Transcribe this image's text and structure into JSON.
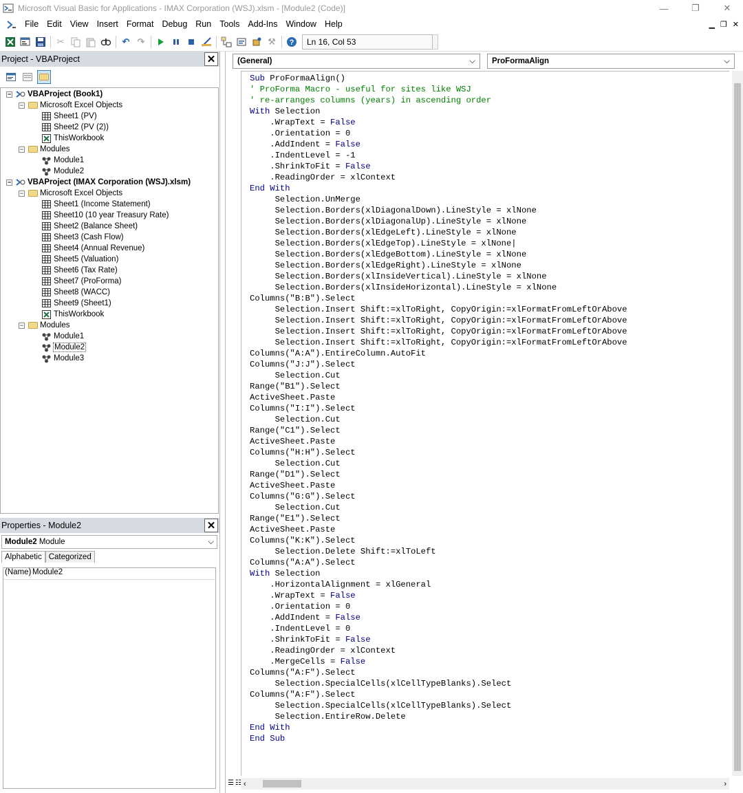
{
  "window": {
    "title": "Microsoft Visual Basic for Applications - IMAX Corporation (WSJ).xlsm - [Module2 (Code)]",
    "min_glyph": "—",
    "max_glyph": "❐",
    "close_glyph": "✕"
  },
  "menu": {
    "items": [
      "File",
      "Edit",
      "View",
      "Insert",
      "Format",
      "Debug",
      "Run",
      "Tools",
      "Add-Ins",
      "Window",
      "Help"
    ],
    "mdi_min": "▁",
    "mdi_restore": "❐",
    "mdi_close": "✕"
  },
  "toolbar": {
    "cursor_position": "Ln 16, Col 53",
    "icons": [
      "excel-icon",
      "insert-userform-icon",
      "save-icon",
      "cut-icon",
      "copy-icon",
      "paste-icon",
      "find-icon",
      "undo-icon",
      "redo-icon",
      "run-icon",
      "break-icon",
      "reset-icon",
      "design-mode-icon",
      "project-explorer-icon",
      "properties-icon",
      "object-browser-icon",
      "toolbox-icon",
      "help-icon"
    ]
  },
  "project_panel": {
    "title": "Project - VBAProject",
    "close": "✕",
    "tree": [
      {
        "label": "VBAProject (Book1)",
        "level": 0,
        "type": "project",
        "expand": "−"
      },
      {
        "label": "Microsoft Excel Objects",
        "level": 1,
        "type": "folder",
        "expand": "−"
      },
      {
        "label": "Sheet1 (PV)",
        "level": 2,
        "type": "sheet"
      },
      {
        "label": "Sheet2 (PV (2))",
        "level": 2,
        "type": "sheet"
      },
      {
        "label": "ThisWorkbook",
        "level": 2,
        "type": "workbook"
      },
      {
        "label": "Modules",
        "level": 1,
        "type": "folder",
        "expand": "−"
      },
      {
        "label": "Module1",
        "level": 2,
        "type": "module"
      },
      {
        "label": "Module2",
        "level": 2,
        "type": "module"
      },
      {
        "label": "VBAProject (IMAX Corporation (WSJ).xlsm)",
        "level": 0,
        "type": "project",
        "expand": "−"
      },
      {
        "label": "Microsoft Excel Objects",
        "level": 1,
        "type": "folder",
        "expand": "−"
      },
      {
        "label": "Sheet1 (Income Statement)",
        "level": 2,
        "type": "sheet"
      },
      {
        "label": "Sheet10 (10 year Treasury Rate)",
        "level": 2,
        "type": "sheet"
      },
      {
        "label": "Sheet2 (Balance Sheet)",
        "level": 2,
        "type": "sheet"
      },
      {
        "label": "Sheet3 (Cash Flow)",
        "level": 2,
        "type": "sheet"
      },
      {
        "label": "Sheet4 (Annual Revenue)",
        "level": 2,
        "type": "sheet"
      },
      {
        "label": "Sheet5 (Valuation)",
        "level": 2,
        "type": "sheet"
      },
      {
        "label": "Sheet6 (Tax Rate)",
        "level": 2,
        "type": "sheet"
      },
      {
        "label": "Sheet7 (ProForma)",
        "level": 2,
        "type": "sheet"
      },
      {
        "label": "Sheet8 (WACC)",
        "level": 2,
        "type": "sheet"
      },
      {
        "label": "Sheet9 (Sheet1)",
        "level": 2,
        "type": "sheet"
      },
      {
        "label": "ThisWorkbook",
        "level": 2,
        "type": "workbook"
      },
      {
        "label": "Modules",
        "level": 1,
        "type": "folder",
        "expand": "−"
      },
      {
        "label": "Module1",
        "level": 2,
        "type": "module"
      },
      {
        "label": "Module2",
        "level": 2,
        "type": "module",
        "selected": true
      },
      {
        "label": "Module3",
        "level": 2,
        "type": "module"
      }
    ]
  },
  "properties_panel": {
    "title": "Properties - Module2",
    "close": "✕",
    "object_name": "Module2",
    "object_type": "Module",
    "tabs": [
      "Alphabetic",
      "Categorized"
    ],
    "rows": [
      {
        "key": "(Name)",
        "value": "Module2"
      }
    ]
  },
  "editor": {
    "object_combo": "(General)",
    "procedure_combo": "ProFormaAlign",
    "code_lines": [
      [
        [
          "kw",
          "Sub"
        ],
        [
          "t",
          " ProFormaAlign()"
        ]
      ],
      [
        [
          "cm",
          "' ProForma Macro - useful for sites like WSJ"
        ]
      ],
      [
        [
          "cm",
          "' re-arranges columns (years) in ascending order"
        ]
      ],
      [
        [
          "kw",
          "With"
        ],
        [
          "t",
          " Selection"
        ]
      ],
      [
        [
          "t",
          "    .WrapText = "
        ],
        [
          "kw",
          "False"
        ]
      ],
      [
        [
          "t",
          "    .Orientation = 0"
        ]
      ],
      [
        [
          "t",
          "    .AddIndent = "
        ],
        [
          "kw",
          "False"
        ]
      ],
      [
        [
          "t",
          "    .IndentLevel = -1"
        ]
      ],
      [
        [
          "t",
          "    .ShrinkToFit = "
        ],
        [
          "kw",
          "False"
        ]
      ],
      [
        [
          "t",
          "    .ReadingOrder = xlContext"
        ]
      ],
      [
        [
          "kw",
          "End With"
        ]
      ],
      [
        [
          "t",
          "     Selection.UnMerge"
        ]
      ],
      [
        [
          "t",
          "     Selection.Borders(xlDiagonalDown).LineStyle = xlNone"
        ]
      ],
      [
        [
          "t",
          "     Selection.Borders(xlDiagonalUp).LineStyle = xlNone"
        ]
      ],
      [
        [
          "t",
          "     Selection.Borders(xlEdgeLeft).LineStyle = xlNone"
        ]
      ],
      [
        [
          "t",
          "     Selection.Borders(xlEdgeTop).LineStyle = xlNone|"
        ]
      ],
      [
        [
          "t",
          "     Selection.Borders(xlEdgeBottom).LineStyle = xlNone"
        ]
      ],
      [
        [
          "t",
          "     Selection.Borders(xlEdgeRight).LineStyle = xlNone"
        ]
      ],
      [
        [
          "t",
          "     Selection.Borders(xlInsideVertical).LineStyle = xlNone"
        ]
      ],
      [
        [
          "t",
          "     Selection.Borders(xlInsideHorizontal).LineStyle = xlNone"
        ]
      ],
      [
        [
          "t",
          "Columns(\"B:B\").Select"
        ]
      ],
      [
        [
          "t",
          "     Selection.Insert Shift:=xlToRight, CopyOrigin:=xlFormatFromLeftOrAbove"
        ]
      ],
      [
        [
          "t",
          "     Selection.Insert Shift:=xlToRight, CopyOrigin:=xlFormatFromLeftOrAbove"
        ]
      ],
      [
        [
          "t",
          "     Selection.Insert Shift:=xlToRight, CopyOrigin:=xlFormatFromLeftOrAbove"
        ]
      ],
      [
        [
          "t",
          "     Selection.Insert Shift:=xlToRight, CopyOrigin:=xlFormatFromLeftOrAbove"
        ]
      ],
      [
        [
          "t",
          "Columns(\"A:A\").EntireColumn.AutoFit"
        ]
      ],
      [
        [
          "t",
          "Columns(\"J:J\").Select"
        ]
      ],
      [
        [
          "t",
          "     Selection.Cut"
        ]
      ],
      [
        [
          "t",
          "Range(\"B1\").Select"
        ]
      ],
      [
        [
          "t",
          "ActiveSheet.Paste"
        ]
      ],
      [
        [
          "t",
          "Columns(\"I:I\").Select"
        ]
      ],
      [
        [
          "t",
          "     Selection.Cut"
        ]
      ],
      [
        [
          "t",
          "Range(\"C1\").Select"
        ]
      ],
      [
        [
          "t",
          "ActiveSheet.Paste"
        ]
      ],
      [
        [
          "t",
          "Columns(\"H:H\").Select"
        ]
      ],
      [
        [
          "t",
          "     Selection.Cut"
        ]
      ],
      [
        [
          "t",
          "Range(\"D1\").Select"
        ]
      ],
      [
        [
          "t",
          "ActiveSheet.Paste"
        ]
      ],
      [
        [
          "t",
          "Columns(\"G:G\").Select"
        ]
      ],
      [
        [
          "t",
          "     Selection.Cut"
        ]
      ],
      [
        [
          "t",
          "Range(\"E1\").Select"
        ]
      ],
      [
        [
          "t",
          "ActiveSheet.Paste"
        ]
      ],
      [
        [
          "t",
          "Columns(\"K:K\").Select"
        ]
      ],
      [
        [
          "t",
          "     Selection.Delete Shift:=xlToLeft"
        ]
      ],
      [
        [
          "t",
          "Columns(\"A:A\").Select"
        ]
      ],
      [
        [
          "kw",
          "With"
        ],
        [
          "t",
          " Selection"
        ]
      ],
      [
        [
          "t",
          "    .HorizontalAlignment = xlGeneral"
        ]
      ],
      [
        [
          "t",
          "    .WrapText = "
        ],
        [
          "kw",
          "False"
        ]
      ],
      [
        [
          "t",
          "    .Orientation = 0"
        ]
      ],
      [
        [
          "t",
          "    .AddIndent = "
        ],
        [
          "kw",
          "False"
        ]
      ],
      [
        [
          "t",
          "    .IndentLevel = 0"
        ]
      ],
      [
        [
          "t",
          "    .ShrinkToFit = "
        ],
        [
          "kw",
          "False"
        ]
      ],
      [
        [
          "t",
          "    .ReadingOrder = xlContext"
        ]
      ],
      [
        [
          "t",
          "    .MergeCells = "
        ],
        [
          "kw",
          "False"
        ]
      ],
      [
        [
          "t",
          "Columns(\"A:F\").Select"
        ]
      ],
      [
        [
          "t",
          "     Selection.SpecialCells(xlCellTypeBlanks).Select"
        ]
      ],
      [
        [
          "t",
          "Columns(\"A:F\").Select"
        ]
      ],
      [
        [
          "t",
          "     Selection.SpecialCells(xlCellTypeBlanks).Select"
        ]
      ],
      [
        [
          "t",
          "     Selection.EntireRow.Delete"
        ]
      ],
      [
        [
          "kw",
          "End With"
        ]
      ],
      [
        [
          "kw",
          "End Sub"
        ]
      ]
    ]
  },
  "colors": {
    "keyword": "#00008b",
    "comment": "#008000",
    "title_text": "#9a9a9a",
    "panel_title_bg": "#d6dbe3"
  }
}
